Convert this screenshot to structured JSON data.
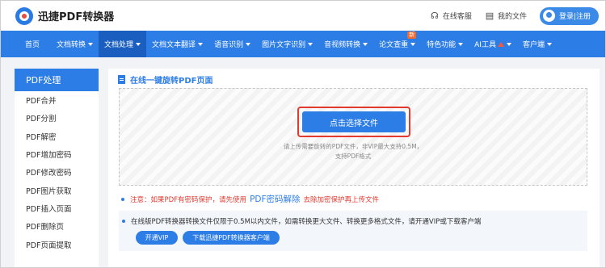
{
  "header": {
    "logo_text": "迅捷PDF转换器",
    "support": "在线客服",
    "my_files": "我的文件",
    "login": "登录|注册"
  },
  "nav": {
    "items": [
      {
        "label": "首页",
        "caret": false
      },
      {
        "label": "文档转换",
        "caret": true
      },
      {
        "label": "文档处理",
        "caret": true,
        "active": true
      },
      {
        "label": "文档文本翻译",
        "caret": true
      },
      {
        "label": "语音识别",
        "caret": true
      },
      {
        "label": "图片文字识别",
        "caret": true
      },
      {
        "label": "音视频转换",
        "caret": true
      },
      {
        "label": "论文查重",
        "caret": true,
        "badge": "新"
      },
      {
        "label": "特色功能",
        "caret": true
      },
      {
        "label": "AI工具",
        "caret": true
      },
      {
        "label": "客户端",
        "caret": true
      }
    ]
  },
  "sidebar": {
    "title": "PDF处理",
    "items": [
      "PDF合并",
      "PDF分割",
      "PDF解密",
      "PDF增加密码",
      "PDF修改密码",
      "PDF图片获取",
      "PDF插入页面",
      "PDF删除页",
      "PDF页面提取"
    ]
  },
  "content": {
    "title": "在线一键旋转PDF页面",
    "select_button": "点击选择文件",
    "hint_line1": "请上传需要旋转的PDF文件，非VIP最大支持0.5M，",
    "hint_line2": "支持PDF格式",
    "notice_prefix": "注意：如果PDF有密码保护，请先使用",
    "notice_link": "PDF密码解除",
    "notice_suffix": "去除加密保护再上传文件",
    "info_text": "在线版PDF转换器转换文件仅限于0.5M以内文件，如需转换更大文件、转换更多格式文件，请开通VIP或下载客户端",
    "vip_button": "开通VIP",
    "download_button": "下载迅捷PDF转换器客户端"
  },
  "colors": {
    "primary": "#2d7de6",
    "nav_active": "#1a5fbf",
    "alert_red": "#e23a2f"
  }
}
